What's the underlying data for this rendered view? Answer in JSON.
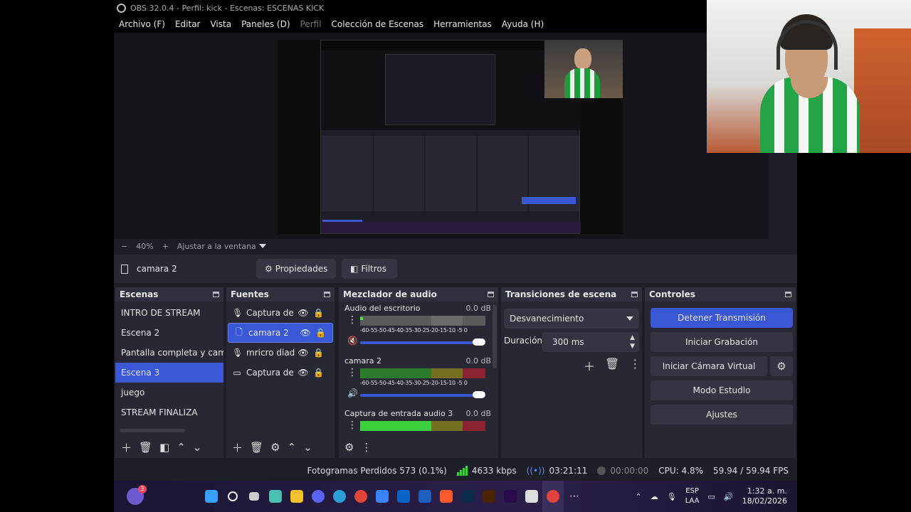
{
  "window": {
    "title": "OBS 32.0.4 - Perfil: kick - Escenas: ESCENAS KICK"
  },
  "menu": [
    "Archivo (F)",
    "Editar",
    "Vista",
    "Paneles (D)",
    "Perfil",
    "Colección de Escenas",
    "Herramientas",
    "Ayuda (H)"
  ],
  "zoom": {
    "minus": "−",
    "level": "40%",
    "plus": "+",
    "fit": "Ajustar a la ventana"
  },
  "source_toolbar": {
    "selected_source": "camara 2",
    "properties": "Propiedades",
    "filters": "Filtros"
  },
  "scenes": {
    "title": "Escenas",
    "items": [
      "INTRO DE STREAM",
      "Escena 2",
      "Pantalla completa y cama",
      "Escena 3",
      "juego",
      "STREAM FINALIZA"
    ],
    "selected_index": 3
  },
  "sources": {
    "title": "Fuentes",
    "items": [
      {
        "name": "Captura de e",
        "icon": "microphone-icon"
      },
      {
        "name": "camara 2",
        "icon": "file-icon"
      },
      {
        "name": "mricro diade",
        "icon": "microphone-icon"
      },
      {
        "name": "Captura de p",
        "icon": "monitor-icon"
      }
    ],
    "selected_index": 1
  },
  "mixer": {
    "title": "Mezclador de audio",
    "ticks": "-60-55-50-45-40-35-30-25-20-15-10 -5  0",
    "channels": [
      {
        "name": "Audio del escritorio",
        "db": "0.0 dB",
        "muted": true,
        "level": 0.2
      },
      {
        "name": "camara 2",
        "db": "0.0 dB",
        "muted": false,
        "level": 0.0
      },
      {
        "name": "Captura de entrada audio 3",
        "db": "0.0 dB",
        "muted": false,
        "level": 0.7
      }
    ]
  },
  "transitions": {
    "title": "Transiciones de escena",
    "selected": "Desvanecimiento",
    "duration_label": "Duración",
    "duration_value": "300 ms"
  },
  "controls": {
    "title": "Controles",
    "stop_stream": "Detener Transmisión",
    "start_recording": "Iniciar Grabación",
    "start_virtual_cam": "Iniciar Cámara Virtual",
    "studio_mode": "Modo Estudio",
    "settings": "Ajustes"
  },
  "status": {
    "dropped_frames": "Fotogramas Perdidos 573 (0.1%)",
    "bitrate": "4633 kbps",
    "stream_time": "03:21:11",
    "rec_time": "00:00:00",
    "cpu": "CPU: 4.8%",
    "fps": "59.94 / 59.94 FPS"
  },
  "taskbar": {
    "notification_count": "3",
    "language": "ESP",
    "layout": "LAA",
    "time": "1:32 a. m.",
    "date": "18/02/2026"
  }
}
